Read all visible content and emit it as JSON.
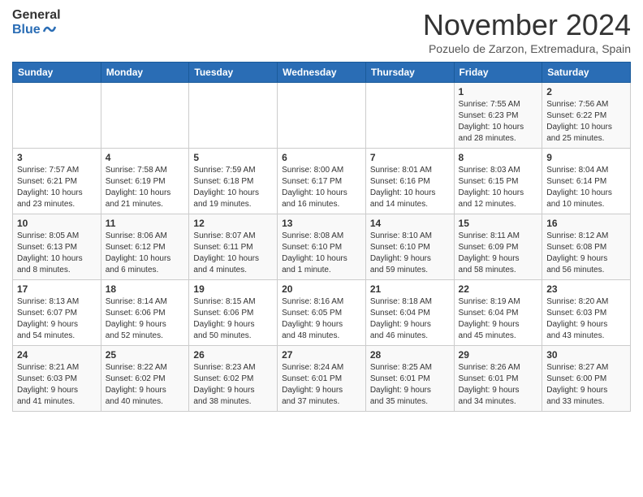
{
  "header": {
    "logo_line1": "General",
    "logo_line2": "Blue",
    "month_title": "November 2024",
    "subtitle": "Pozuelo de Zarzon, Extremadura, Spain"
  },
  "weekdays": [
    "Sunday",
    "Monday",
    "Tuesday",
    "Wednesday",
    "Thursday",
    "Friday",
    "Saturday"
  ],
  "weeks": [
    [
      {
        "day": "",
        "info": ""
      },
      {
        "day": "",
        "info": ""
      },
      {
        "day": "",
        "info": ""
      },
      {
        "day": "",
        "info": ""
      },
      {
        "day": "",
        "info": ""
      },
      {
        "day": "1",
        "info": "Sunrise: 7:55 AM\nSunset: 6:23 PM\nDaylight: 10 hours\nand 28 minutes."
      },
      {
        "day": "2",
        "info": "Sunrise: 7:56 AM\nSunset: 6:22 PM\nDaylight: 10 hours\nand 25 minutes."
      }
    ],
    [
      {
        "day": "3",
        "info": "Sunrise: 7:57 AM\nSunset: 6:21 PM\nDaylight: 10 hours\nand 23 minutes."
      },
      {
        "day": "4",
        "info": "Sunrise: 7:58 AM\nSunset: 6:19 PM\nDaylight: 10 hours\nand 21 minutes."
      },
      {
        "day": "5",
        "info": "Sunrise: 7:59 AM\nSunset: 6:18 PM\nDaylight: 10 hours\nand 19 minutes."
      },
      {
        "day": "6",
        "info": "Sunrise: 8:00 AM\nSunset: 6:17 PM\nDaylight: 10 hours\nand 16 minutes."
      },
      {
        "day": "7",
        "info": "Sunrise: 8:01 AM\nSunset: 6:16 PM\nDaylight: 10 hours\nand 14 minutes."
      },
      {
        "day": "8",
        "info": "Sunrise: 8:03 AM\nSunset: 6:15 PM\nDaylight: 10 hours\nand 12 minutes."
      },
      {
        "day": "9",
        "info": "Sunrise: 8:04 AM\nSunset: 6:14 PM\nDaylight: 10 hours\nand 10 minutes."
      }
    ],
    [
      {
        "day": "10",
        "info": "Sunrise: 8:05 AM\nSunset: 6:13 PM\nDaylight: 10 hours\nand 8 minutes."
      },
      {
        "day": "11",
        "info": "Sunrise: 8:06 AM\nSunset: 6:12 PM\nDaylight: 10 hours\nand 6 minutes."
      },
      {
        "day": "12",
        "info": "Sunrise: 8:07 AM\nSunset: 6:11 PM\nDaylight: 10 hours\nand 4 minutes."
      },
      {
        "day": "13",
        "info": "Sunrise: 8:08 AM\nSunset: 6:10 PM\nDaylight: 10 hours\nand 1 minute."
      },
      {
        "day": "14",
        "info": "Sunrise: 8:10 AM\nSunset: 6:10 PM\nDaylight: 9 hours\nand 59 minutes."
      },
      {
        "day": "15",
        "info": "Sunrise: 8:11 AM\nSunset: 6:09 PM\nDaylight: 9 hours\nand 58 minutes."
      },
      {
        "day": "16",
        "info": "Sunrise: 8:12 AM\nSunset: 6:08 PM\nDaylight: 9 hours\nand 56 minutes."
      }
    ],
    [
      {
        "day": "17",
        "info": "Sunrise: 8:13 AM\nSunset: 6:07 PM\nDaylight: 9 hours\nand 54 minutes."
      },
      {
        "day": "18",
        "info": "Sunrise: 8:14 AM\nSunset: 6:06 PM\nDaylight: 9 hours\nand 52 minutes."
      },
      {
        "day": "19",
        "info": "Sunrise: 8:15 AM\nSunset: 6:06 PM\nDaylight: 9 hours\nand 50 minutes."
      },
      {
        "day": "20",
        "info": "Sunrise: 8:16 AM\nSunset: 6:05 PM\nDaylight: 9 hours\nand 48 minutes."
      },
      {
        "day": "21",
        "info": "Sunrise: 8:18 AM\nSunset: 6:04 PM\nDaylight: 9 hours\nand 46 minutes."
      },
      {
        "day": "22",
        "info": "Sunrise: 8:19 AM\nSunset: 6:04 PM\nDaylight: 9 hours\nand 45 minutes."
      },
      {
        "day": "23",
        "info": "Sunrise: 8:20 AM\nSunset: 6:03 PM\nDaylight: 9 hours\nand 43 minutes."
      }
    ],
    [
      {
        "day": "24",
        "info": "Sunrise: 8:21 AM\nSunset: 6:03 PM\nDaylight: 9 hours\nand 41 minutes."
      },
      {
        "day": "25",
        "info": "Sunrise: 8:22 AM\nSunset: 6:02 PM\nDaylight: 9 hours\nand 40 minutes."
      },
      {
        "day": "26",
        "info": "Sunrise: 8:23 AM\nSunset: 6:02 PM\nDaylight: 9 hours\nand 38 minutes."
      },
      {
        "day": "27",
        "info": "Sunrise: 8:24 AM\nSunset: 6:01 PM\nDaylight: 9 hours\nand 37 minutes."
      },
      {
        "day": "28",
        "info": "Sunrise: 8:25 AM\nSunset: 6:01 PM\nDaylight: 9 hours\nand 35 minutes."
      },
      {
        "day": "29",
        "info": "Sunrise: 8:26 AM\nSunset: 6:01 PM\nDaylight: 9 hours\nand 34 minutes."
      },
      {
        "day": "30",
        "info": "Sunrise: 8:27 AM\nSunset: 6:00 PM\nDaylight: 9 hours\nand 33 minutes."
      }
    ]
  ]
}
